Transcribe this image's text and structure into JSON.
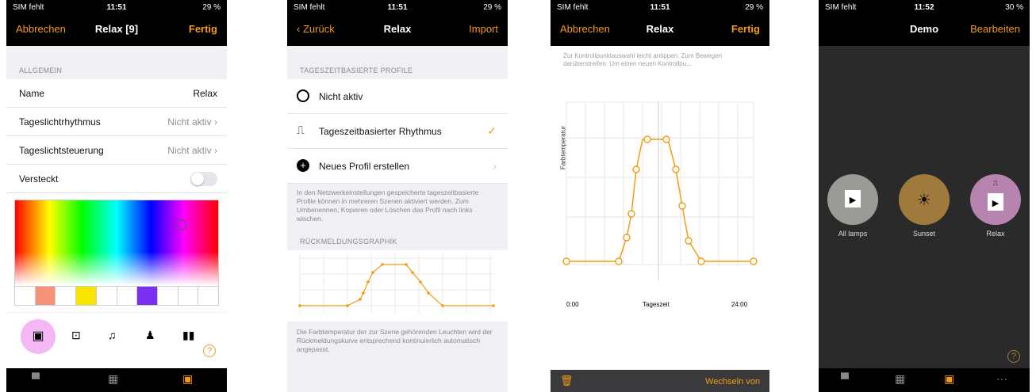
{
  "screen1": {
    "status": {
      "carrier": "SIM fehlt",
      "time": "11:51",
      "battery": "29 %"
    },
    "nav": {
      "left": "Abbrechen",
      "title": "Relax [9]",
      "right": "Fertig"
    },
    "section": "ALLGEMEIN",
    "rows": [
      {
        "label": "Name",
        "value": "Relax"
      },
      {
        "label": "Tageslichtrhythmus",
        "value": "Nicht aktiv"
      },
      {
        "label": "Tageslichtsteuerung",
        "value": "Nicht aktiv"
      },
      {
        "label": "Versteckt",
        "value": ""
      }
    ],
    "swatch_colors": [
      "#ffffff",
      "#f4927a",
      "#ffffff",
      "#f7e400",
      "#ffffff",
      "#ffffff",
      "#7b2ff0",
      "#ffffff",
      "#ffffff",
      "#ffffff"
    ],
    "help": "?"
  },
  "screen2": {
    "status": {
      "carrier": "SIM fehlt",
      "time": "11:51",
      "battery": "29 %"
    },
    "nav": {
      "left": "Zurück",
      "title": "Relax",
      "right": "Import"
    },
    "section1": "TAGESZEITBASIERTE PROFILE",
    "items": [
      {
        "label": "Nicht aktiv"
      },
      {
        "label": "Tageszeitbasierter Rhythmus"
      },
      {
        "label": "Neues Profil erstellen"
      }
    ],
    "note1": "In den Netzwerkeinstellungen gespeicherte tageszeitbasierte Profile können in mehreren Szenen aktiviert werden. Zum Umbenennen, Kopieren oder Löschen das Profil nach links wischen.",
    "section2": "RÜCKMELDUNGSGRAPHIK",
    "note2": "Die Farbtemperatur der zur Szene gehörenden Leuchten wird der Rückmeldungskurve entsprechend kontinuierlich automatisch angepasst."
  },
  "screen3": {
    "status": {
      "carrier": "SIM fehlt",
      "time": "11:51",
      "battery": "29 %"
    },
    "nav": {
      "left": "Abbrechen",
      "title": "Relax",
      "right": "Fertig"
    },
    "hint": "Zur Kontrollpunktauswahl leicht antippen. Zum Bewegen darüberstreifen. Um einen neuen Kontrollpu...",
    "ylabel": "Farbtemperatur",
    "xstart": "0:00",
    "xmid": "Tageszeit",
    "xend": "24:00",
    "bottom_right": "Wechseln von"
  },
  "screen4": {
    "status": {
      "carrier": "SIM fehlt",
      "time": "11:52",
      "battery": "30 %"
    },
    "nav": {
      "title": "Demo",
      "right": "Bearbeiten"
    },
    "scenes": [
      {
        "label": "All lamps",
        "color": "#9a9a96"
      },
      {
        "label": "Sunset",
        "color": "#a07a3c"
      },
      {
        "label": "Relax",
        "color": "#b784b0"
      }
    ],
    "help": "?",
    "more": "···"
  }
}
